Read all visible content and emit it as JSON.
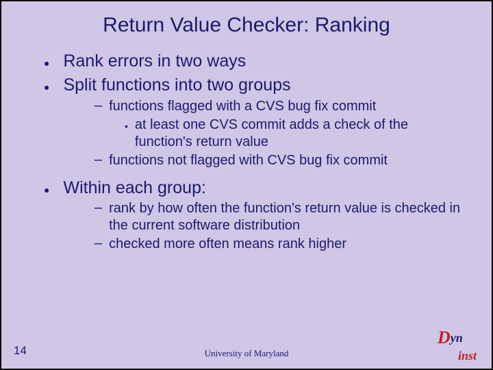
{
  "title": "Return Value Checker: Ranking",
  "bullets": {
    "b1": "Rank errors in two ways",
    "b2": "Split functions into two groups",
    "b2s1": "functions flagged with a CVS bug fix commit",
    "b2s1a": "at least one CVS commit adds a check of the function's return value",
    "b2s2": "functions not flagged with CVS bug fix commit",
    "b3": "Within each group:",
    "b3s1": "rank by how often the function's return value is checked in the current software distribution",
    "b3s2": "checked more often means rank higher"
  },
  "footer": {
    "page": "14",
    "org": "University of Maryland"
  },
  "logo": {
    "d": "D",
    "yn": "yn",
    "inst": "inst"
  }
}
